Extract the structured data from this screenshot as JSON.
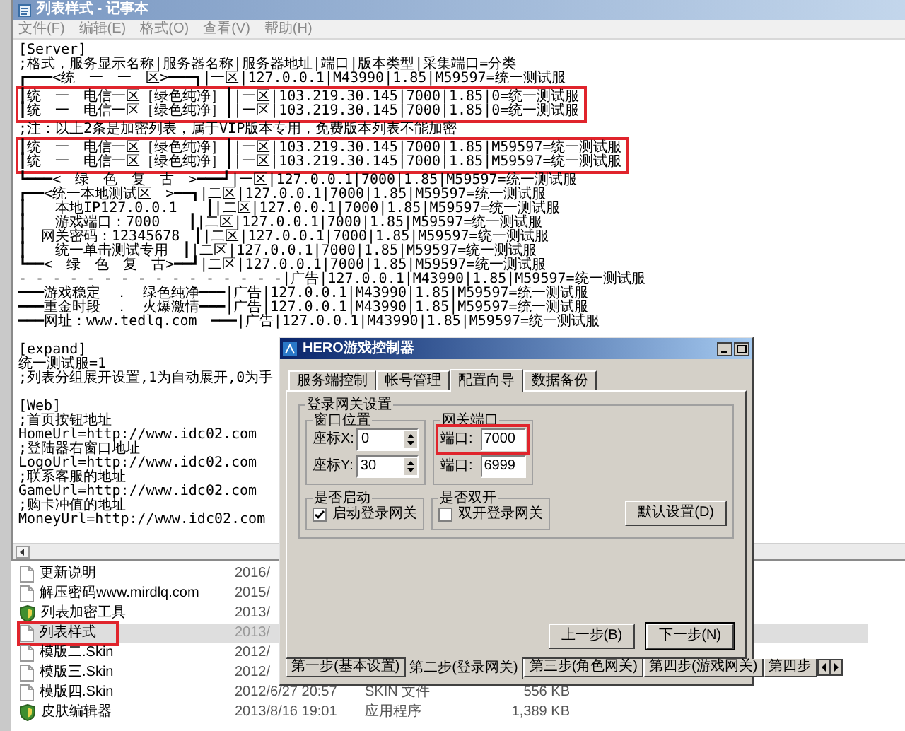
{
  "notepad": {
    "title": "列表样式 - 记事本",
    "menu": [
      "文件(F)",
      "编辑(E)",
      "格式(O)",
      "查看(V)",
      "帮助(H)"
    ],
    "sections": [
      {
        "lines": [
          {
            "text": "[Server]",
            "marked": false
          },
          {
            "text": ";格式，服务显示名称|服务器名称|服务器地址|端口|版本类型|采集端口=分类",
            "marked": false
          },
          {
            "text": "┏━━━<统　一　一　区>━━━┓|一区|127.0.0.1|M43990|1.85|M59597=统一测试服",
            "marked": false
          },
          {
            "text": "┃统　一　电信一区［绿色纯净］┃|一区|103.219.30.145|7000|1.85|0=统一测试服",
            "marked": true
          },
          {
            "text": "┃统　一　电信一区［绿色纯净］┃|一区|103.219.30.145|7000|1.85|0=统一测试服",
            "marked": true
          },
          {
            "text": ";注：以上2条是加密列表，属于VIP版本专用，免费版本列表不能加密",
            "marked": false
          },
          {
            "text": "┃统　一　电信一区［绿色纯净］┃|一区|103.219.30.145|7000|1.85|M59597=统一测试服",
            "marked": true
          },
          {
            "text": "┃统　一　电信一区［绿色纯净］┃|一区|103.219.30.145|7000|1.85|M59597=统一测试服",
            "marked": true
          },
          {
            "text": "┗━━━<　绿　色　复　古　>━━━┛|一区|127.0.0.1|7000|1.85|M59597=统一测试服",
            "marked": false
          },
          {
            "text": "┏━━<统一本地测试区　>━━┓|二区|127.0.0.1|7000|1.85|M59597=统一测试服",
            "marked": false
          },
          {
            "text": "┃　　本地IP127.0.0.1　　┃|二区|127.0.0.1|7000|1.85|M59597=统一测试服",
            "marked": false
          },
          {
            "text": "┃　　游戏端口：7000　　┃|二区|127.0.0.1|7000|1.85|M59597=统一测试服",
            "marked": false
          },
          {
            "text": "┃　网关密码：12345678　┃|二区|127.0.0.1|7000|1.85|M59597=统一测试服",
            "marked": false
          },
          {
            "text": "┃　　统一单击测试专用　┃|二区|127.0.0.1|7000|1.85|M59597=统一测试服",
            "marked": false
          },
          {
            "text": "┗━━<　绿　色　复　古>━━┛|二区|127.0.0.1|7000|1.85|M59597=统一测试服",
            "marked": false
          },
          {
            "text": "- - - - - - - - - - - - - - - -|广告|127.0.0.1|M43990|1.85|M59597=统一测试服",
            "marked": false
          },
          {
            "text": "━━━游戏稳定　．　绿色纯净━━━|广告|127.0.0.1|M43990|1.85|M59597=统一测试服",
            "marked": false
          },
          {
            "text": "━━━重金时段　．　火爆激情━━━|广告|127.0.0.1|M43990|1.85|M59597=统一测试服",
            "marked": false
          },
          {
            "text": "━━━网址：www.tedlq.com　━━━|广告|127.0.0.1|M43990|1.85|M59597=统一测试服",
            "marked": false
          }
        ]
      },
      {
        "lines": [
          {
            "text": "[expand]",
            "marked": false
          },
          {
            "text": "统一测试服=1",
            "marked": false
          },
          {
            "text": ";列表分组展开设置,1为自动展开,0为手",
            "marked": false
          }
        ]
      },
      {
        "lines": [
          {
            "text": "[Web]",
            "marked": false
          },
          {
            "text": ";首页按钮地址",
            "marked": false
          },
          {
            "text": "HomeUrl=http://www.idc02.com",
            "marked": false
          },
          {
            "text": ";登陆器右窗口地址",
            "marked": false
          },
          {
            "text": "LogoUrl=http://www.idc02.com",
            "marked": false
          },
          {
            "text": ";联系客服的地址",
            "marked": false
          },
          {
            "text": "GameUrl=http://www.idc02.com",
            "marked": false
          },
          {
            "text": ";购卡冲值的地址",
            "marked": false
          },
          {
            "text": "MoneyUrl=http://www.idc02.com",
            "marked": false
          }
        ]
      }
    ]
  },
  "files": [
    {
      "kind": "file",
      "name": "更新说明",
      "date": "2016/",
      "selected": false,
      "marked": false
    },
    {
      "kind": "file",
      "name": "解压密码www.mirdlq.com",
      "date": "2015/",
      "selected": false,
      "marked": false
    },
    {
      "kind": "program",
      "name": "列表加密工具",
      "date": "2013/",
      "selected": false,
      "marked": false
    },
    {
      "kind": "file",
      "name": "列表样式",
      "date": "2013/",
      "selected": true,
      "marked": true
    },
    {
      "kind": "file",
      "name": "模版二.Skin",
      "date": "2012/",
      "selected": false,
      "marked": false
    },
    {
      "kind": "file",
      "name": "模版三.Skin",
      "date": "2012/",
      "selected": false,
      "marked": false
    },
    {
      "kind": "file",
      "name": "模版四.Skin",
      "date": "2012/6/27 20:57",
      "type": "SKIN 文件",
      "size": "556 KB",
      "selected": false,
      "marked": false
    },
    {
      "kind": "program",
      "name": "皮肤编辑器",
      "date": "2013/8/16 19:01",
      "type": "应用程序",
      "size": "1,389 KB",
      "selected": false,
      "marked": false
    }
  ],
  "dialog": {
    "title": "HERO游戏控制器",
    "tabs": [
      {
        "label": "服务端控制",
        "selected": false
      },
      {
        "label": "帐号管理",
        "selected": false
      },
      {
        "label": "配置向导",
        "selected": true
      },
      {
        "label": "数据备份",
        "selected": false
      }
    ],
    "group_title": "登录网关设置",
    "window_position": {
      "title": "窗口位置",
      "fields": [
        {
          "label": "座标X:",
          "value": "0"
        },
        {
          "label": "座标Y:",
          "value": "30"
        }
      ]
    },
    "gateway_port": {
      "title": "网关端口",
      "fields": [
        {
          "label": "端口:",
          "value": "7000",
          "marked": true
        },
        {
          "label": "端口:",
          "value": "6999",
          "marked": false
        }
      ]
    },
    "autostart": {
      "title": "是否启动",
      "label": "启动登录网关",
      "checked": true
    },
    "dual": {
      "title": "是否双开",
      "label": "双开登录网关",
      "checked": false
    },
    "default_button": "默认设置(D)",
    "prev_button": "上一步(B)",
    "next_button": "下一步(N)",
    "steps": [
      {
        "label": "第一步(基本设置)",
        "selected": false
      },
      {
        "label": "第二步(登录网关)",
        "selected": true
      },
      {
        "label": "第三步(角色网关)",
        "selected": false
      },
      {
        "label": "第四步(游戏网关)",
        "selected": false
      },
      {
        "label": "第四步",
        "selected": false
      }
    ]
  }
}
